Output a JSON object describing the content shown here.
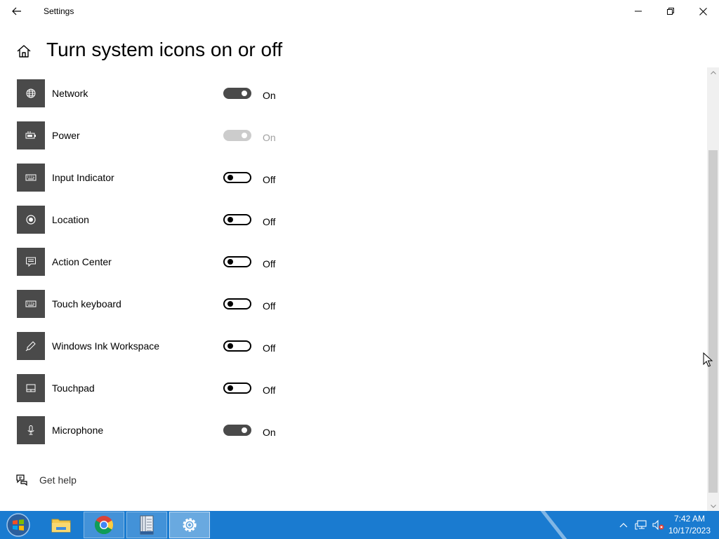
{
  "window": {
    "title": "Settings",
    "controls": {
      "minimize_icon": "minimize-icon",
      "maximize_icon": "restore-icon",
      "close_icon": "close-icon"
    }
  },
  "header": {
    "home_icon": "home-icon",
    "title": "Turn system icons on or off"
  },
  "settings": [
    {
      "label": "Network",
      "icon": "globe-icon",
      "state": "On",
      "enabled": true
    },
    {
      "label": "Power",
      "icon": "battery-icon",
      "state": "On",
      "enabled": false
    },
    {
      "label": "Input Indicator",
      "icon": "keyboard-icon",
      "state": "Off",
      "enabled": true
    },
    {
      "label": "Location",
      "icon": "location-icon",
      "state": "Off",
      "enabled": true
    },
    {
      "label": "Action Center",
      "icon": "action-center-icon",
      "state": "Off",
      "enabled": true
    },
    {
      "label": "Touch keyboard",
      "icon": "keyboard-icon",
      "state": "Off",
      "enabled": true
    },
    {
      "label": "Windows Ink Workspace",
      "icon": "pen-icon",
      "state": "Off",
      "enabled": true
    },
    {
      "label": "Touchpad",
      "icon": "touchpad-icon",
      "state": "Off",
      "enabled": true
    },
    {
      "label": "Microphone",
      "icon": "microphone-icon",
      "state": "On",
      "enabled": true
    }
  ],
  "help": {
    "label": "Get help",
    "icon": "chat-help-icon"
  },
  "taskbar": {
    "apps": [
      "start-orb-icon",
      "file-explorer-icon",
      "chrome-icon",
      "notepad-icon",
      "settings-gear-icon"
    ],
    "tray": [
      "show-hidden-icons-chevron",
      "network-icon",
      "volume-muted-icon"
    ],
    "time": "7:42 AM",
    "date": "10/17/2023"
  },
  "colors": {
    "accent_dark": "#4a4a4a",
    "taskbar": "#1a7bd0",
    "disabled": "#cccccc"
  }
}
